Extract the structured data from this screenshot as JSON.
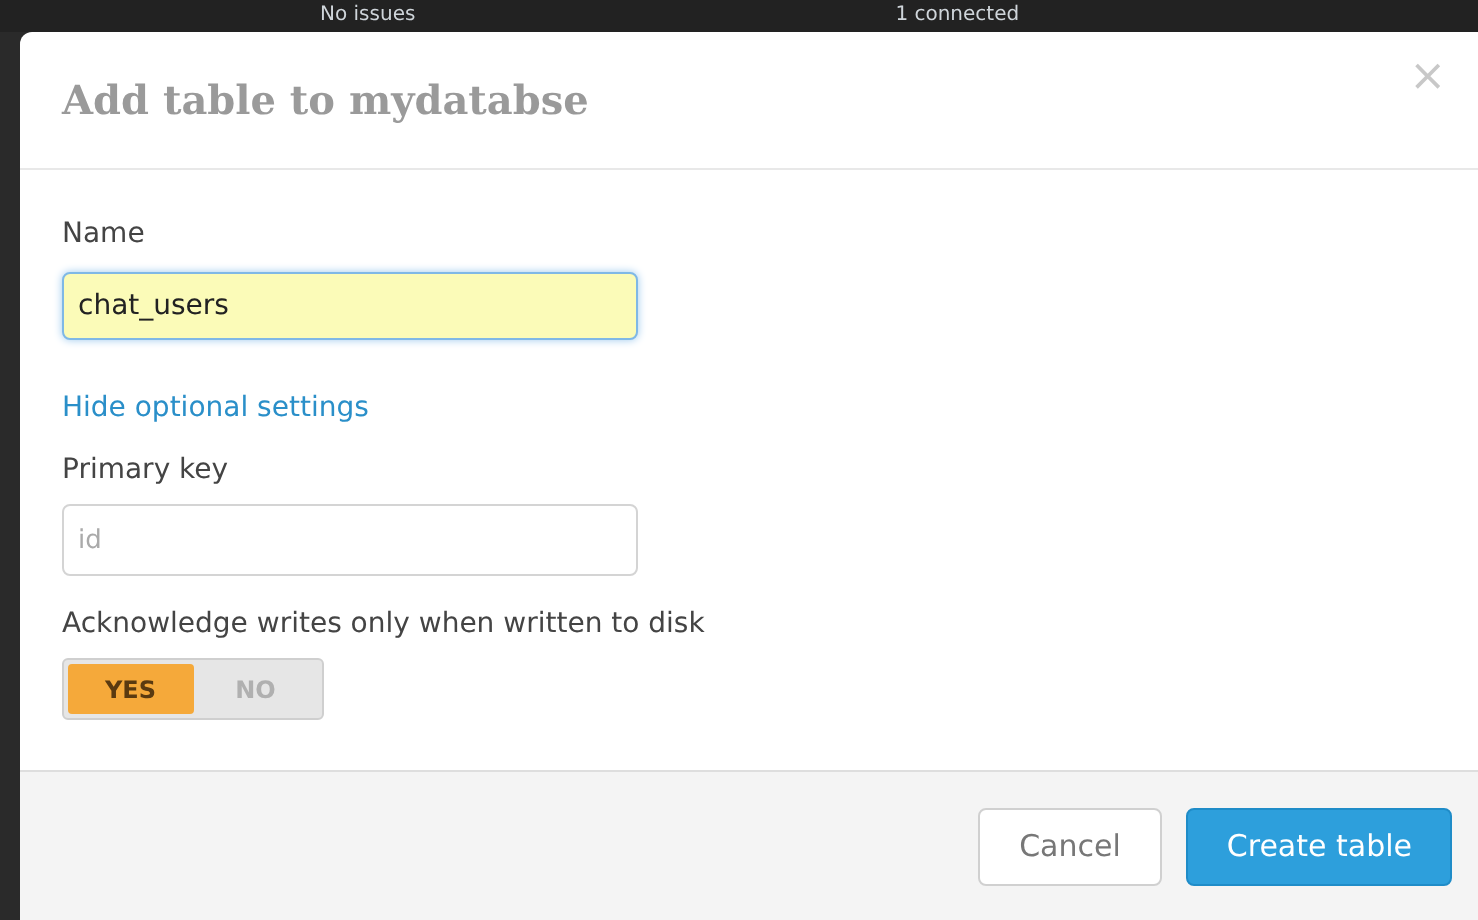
{
  "background": {
    "status_items": [
      "No issues",
      "1 connected"
    ]
  },
  "dialog": {
    "title": "Add table to mydatabse",
    "close": "×",
    "name_field": {
      "label": "Name",
      "value": "chat_users",
      "focused": true
    },
    "options_link": "Hide optional settings",
    "primary_key_field": {
      "label": "Primary key",
      "placeholder": "id"
    },
    "durability": {
      "label": "Acknowledge writes only when written to disk",
      "options": [
        {
          "label": "YES",
          "selected": true
        },
        {
          "label": "NO",
          "selected": false
        }
      ]
    },
    "buttons": [
      {
        "label": "Cancel",
        "kind": "secondary"
      },
      {
        "label": "Create table",
        "kind": "primary"
      }
    ]
  }
}
